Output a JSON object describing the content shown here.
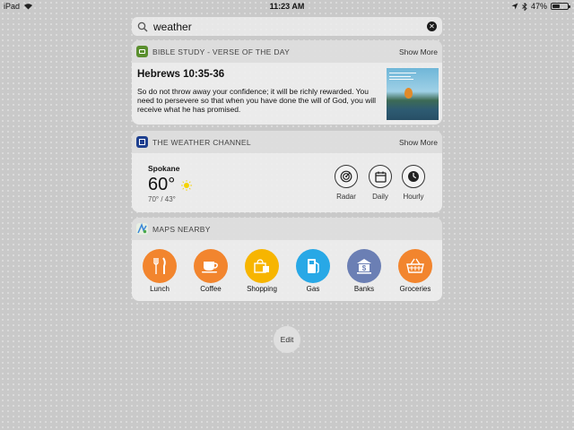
{
  "status_bar": {
    "device": "iPad",
    "time": "11:23 AM",
    "battery": "47%",
    "battery_level": 0.47
  },
  "search": {
    "query": "weather"
  },
  "bible_widget": {
    "title": "BIBLE STUDY - VERSE OF THE DAY",
    "show_more": "Show More",
    "reference": "Hebrews 10:35-36",
    "verse": "So do not throw away your confidence; it will be richly rewarded. You need to persevere so that when you have done the will of God, you will receive what he has promised."
  },
  "weather_widget": {
    "title": "THE WEATHER CHANNEL",
    "show_more": "Show More",
    "city": "Spokane",
    "temperature": "60°",
    "hi_lo": "70° / 43°",
    "buttons": [
      {
        "label": "Radar",
        "icon": "radar-icon"
      },
      {
        "label": "Daily",
        "icon": "calendar-icon"
      },
      {
        "label": "Hourly",
        "icon": "clock-icon"
      }
    ]
  },
  "maps_widget": {
    "title": "MAPS NEARBY",
    "items": [
      {
        "label": "Lunch",
        "icon": "fork-knife-icon",
        "color": "#f2852e"
      },
      {
        "label": "Coffee",
        "icon": "coffee-cup-icon",
        "color": "#f2852e"
      },
      {
        "label": "Shopping",
        "icon": "shopping-bag-icon",
        "color": "#f7b500"
      },
      {
        "label": "Gas",
        "icon": "gas-pump-icon",
        "color": "#28a8e6"
      },
      {
        "label": "Banks",
        "icon": "bank-icon",
        "color": "#6b7fb4"
      },
      {
        "label": "Groceries",
        "icon": "basket-icon",
        "color": "#f2852e"
      }
    ]
  },
  "edit": {
    "label": "Edit"
  }
}
